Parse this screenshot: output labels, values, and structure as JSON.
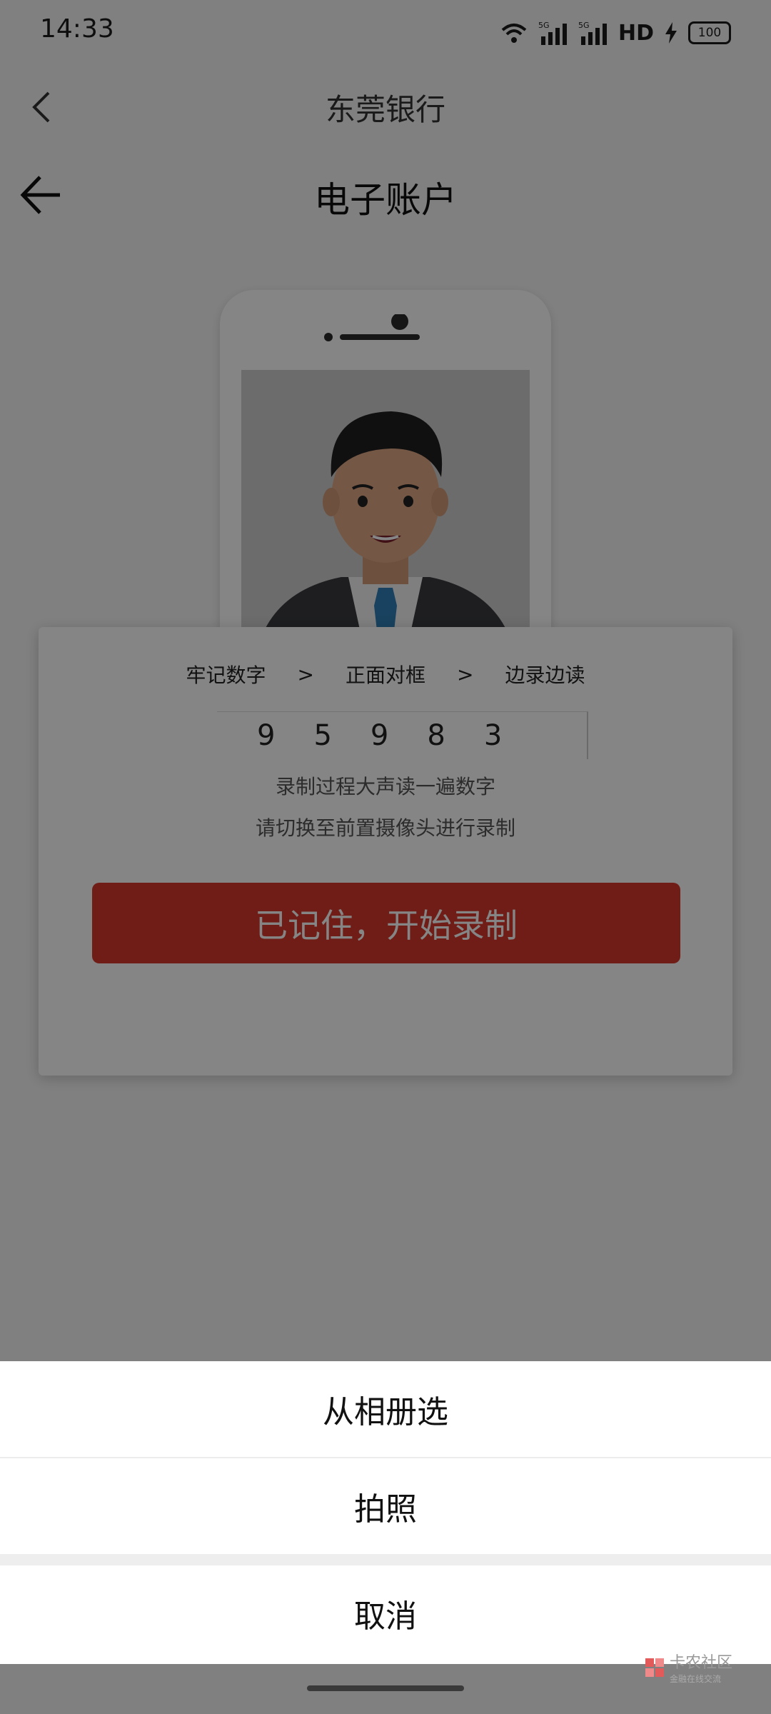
{
  "status_bar": {
    "time": "14:33",
    "net_label": "5G",
    "hd_label": "HD",
    "battery": "100"
  },
  "nav_bank": {
    "title": "东莞银行"
  },
  "nav_page": {
    "title": "电子账户"
  },
  "card": {
    "steps": [
      "牢记数字",
      ">",
      "正面对框",
      ">",
      "边录边读"
    ],
    "digits": [
      "9",
      "5",
      "9",
      "8",
      "3"
    ],
    "hint1": "录制过程大声读一遍数字",
    "hint2": "请切换至前置摄像头进行录制",
    "record_button": "已记住，开始录制"
  },
  "action_sheet": {
    "items": [
      "从相册选",
      "拍照"
    ],
    "cancel": "取消"
  },
  "watermark": {
    "text": "卡农社区",
    "sub": "金融在线交流"
  },
  "colors": {
    "accent_red": "#d9392d",
    "overlay": "rgba(0,0,0,0.48)"
  }
}
